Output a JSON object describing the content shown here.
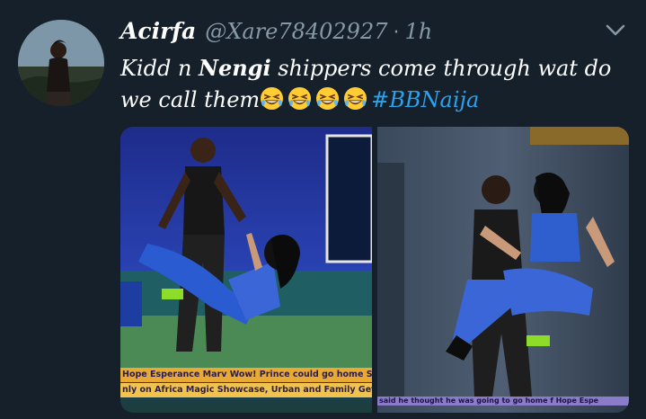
{
  "tweet": {
    "display_name": "Acirfa",
    "handle": "@Xare78402927",
    "separator": "·",
    "time": "1h",
    "text_part1": "Kidd n ",
    "text_bold": "Nengi",
    "text_part2": " shippers come through wat do we call them",
    "emoji_name": "grinning-squinting-face-icon",
    "emoji_count": 4,
    "hashtag": "#BBNaija"
  },
  "media": {
    "left_ticker_line1": "Hope Esperance Marv Wow! Prince could go home Soon   f Ben",
    "left_ticker_line2": "nly on Africa Magic Showcase, Urban and Family  Get the DS",
    "right_ticker": "said he thought he was going to go home    f Hope Espe"
  },
  "icons": {
    "caret": "chevron-down-icon"
  },
  "colors": {
    "background": "#15202b",
    "secondary_text": "#8899a6",
    "hashtag": "#2aa3ef",
    "ticker": "#e8a935"
  }
}
